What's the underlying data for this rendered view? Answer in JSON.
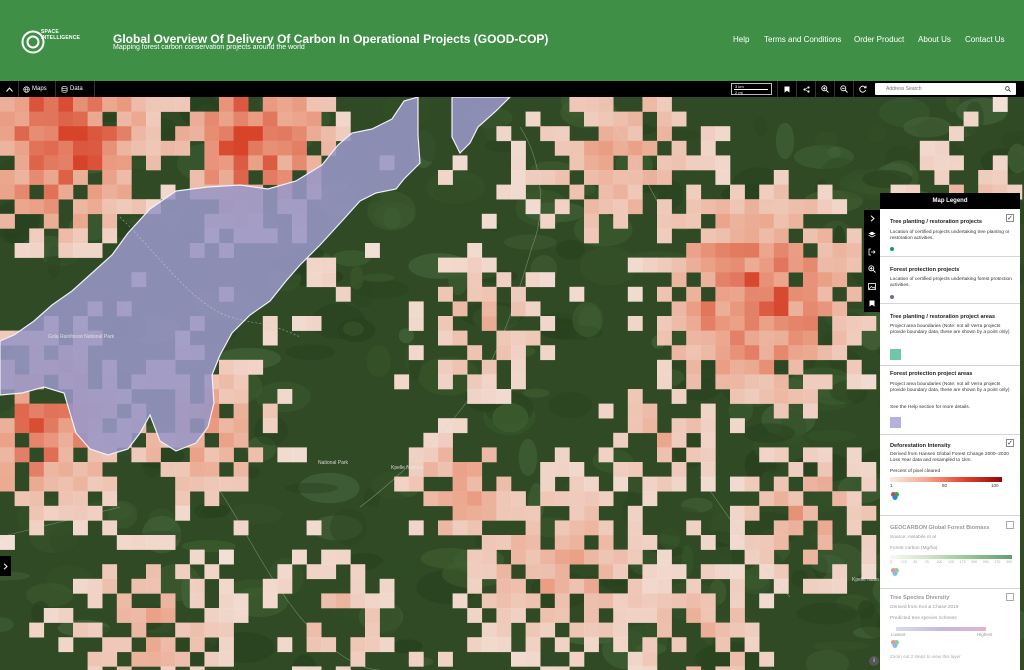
{
  "header": {
    "logo_text": "SPACE INTELLIGENCE",
    "title": "Global Overview Of Delivery Of Carbon In Operational Projects (GOOD-COP)",
    "subtitle": "Mapping forest carbon conservation projects around the world",
    "nav": [
      {
        "label": "Help"
      },
      {
        "label": "Terms and Conditions"
      },
      {
        "label": "Order Product"
      },
      {
        "label": "About Us"
      },
      {
        "label": "Contact Us"
      }
    ]
  },
  "toolbar": {
    "maps_label": "Maps",
    "data_label": "Data",
    "scale_top": "3 km",
    "scale_bottom": "2 mi",
    "search_placeholder": "Address Search"
  },
  "map": {
    "labels": {
      "park1": "Gola Rainforest National Park",
      "park2": "National Park",
      "park3": "Kpelle Nationa",
      "park4": "Kpelle Natio"
    },
    "colors": {
      "forest": "#2f4a24",
      "protection_area": "#9896c6",
      "deforestation_low": "#fde9e2",
      "deforestation_mid": "#f4a58c",
      "deforestation_high": "#e0432b"
    }
  },
  "legend": {
    "title": "Map Legend",
    "sections": {
      "tree_planting": {
        "title": "Tree planting / restoration projects",
        "desc": "Location of certified projects undertaking tree planting or restoration activities.",
        "color": "#1b9a6a"
      },
      "forest_protection": {
        "title": "Forest protection projects",
        "desc": "Location of certified projects undertaking forest protection activities.",
        "color": "#6a6aa8"
      },
      "tree_planting_areas": {
        "title": "Tree planting / restoration project areas",
        "desc": "Project area boundaries (Note: not all Verra projects provide boundary data, these are shown by a point only)",
        "color": "#6fc7a6"
      },
      "forest_protection_areas": {
        "title": "Forest protection project areas",
        "desc": "Project area boundaries (Note: not all Verra projects provide boundary data, these are shown by a point only)",
        "note": "See the Help section for more details.",
        "color": "#b3b1de"
      },
      "deforestation": {
        "title": "Deforestation Intensity",
        "desc": "Derived from Hansen Global Forest Change 2000–2020 Loss Year data and resampled to 1km.",
        "units": "Percent of pixel cleared",
        "ticks": [
          "1",
          "50",
          "100"
        ]
      },
      "biomass": {
        "title": "GEOCARBON Global Forest Biomass",
        "desc": "Source: Avitabile et al",
        "units": "Forest carbon (Mg/ha)",
        "ticks": [
          "0",
          "0.5",
          "25",
          "75",
          "100",
          "125",
          "175",
          "200",
          "250",
          "275",
          "300"
        ]
      },
      "species": {
        "title": "Tree Species Diversity",
        "desc": "Derived from Keil & Chase 2019",
        "units": "Predicted tree species richness",
        "low": "Lowest",
        "high": "Highest"
      }
    },
    "footnote": "Zoom out 2 steps to view this layer"
  }
}
